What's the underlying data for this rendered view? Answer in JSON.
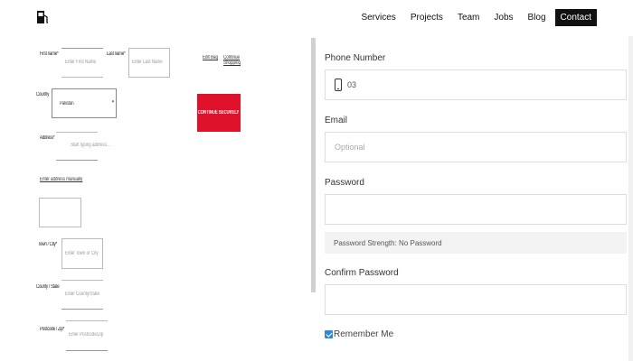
{
  "nav": {
    "items": [
      "Services",
      "Projects",
      "Team",
      "Jobs",
      "Blog",
      "Contact"
    ],
    "active": "Contact"
  },
  "left_form": {
    "first_name_label": "First name*",
    "first_name_placeholder": "Enter First Name",
    "last_name_label": "Last name*",
    "last_name_placeholder": "Enter Last Name",
    "country_label": "Country",
    "country_value": "Pakistan",
    "address_label": "Address*",
    "address_placeholder": "Start typing address...",
    "enter_address_manually": "Enter address manually",
    "town_city_label": "Town / City*",
    "town_city_placeholder": "Enter Town or City",
    "county_state_label": "County / State",
    "county_state_placeholder": "Enter County/State",
    "postcode_label": "Postcode / Zip*",
    "postcode_placeholder": "Enter Postcode/Zip",
    "edit_link": "Edit Bag",
    "continue_shopping_link": "Continue Shopping",
    "cta_label": "CONTINUE SECURELY"
  },
  "right_form": {
    "phone_label": "Phone Number",
    "phone_value": "03",
    "email_label": "Email",
    "email_placeholder": "Optional",
    "password_label": "Password",
    "password_strength": "Password Strength: No Password",
    "confirm_password_label": "Confirm Password",
    "remember_label": "Remember Me",
    "remember_checked": true
  },
  "colors": {
    "accent_red": "#e0112b",
    "checkbox_blue": "#2a8cd7",
    "nav_active_bg": "#111111"
  },
  "icons": {
    "logo": "fuel-pump-icon",
    "phone": "mobile-phone-icon"
  }
}
